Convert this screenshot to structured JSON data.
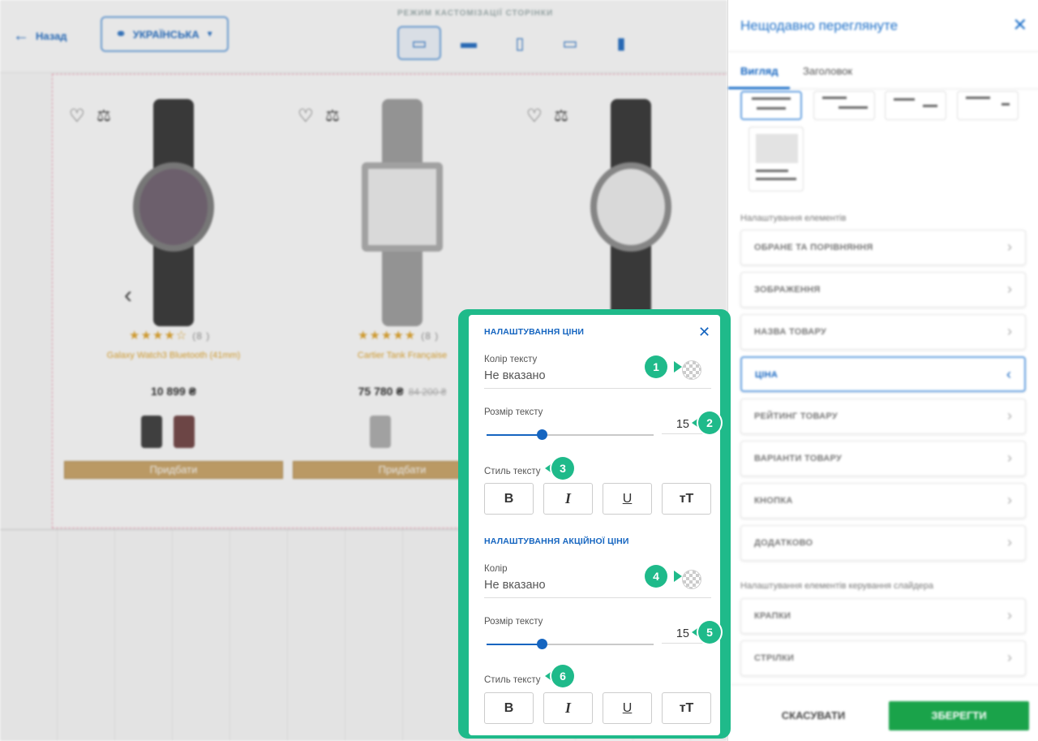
{
  "header": {
    "back_label": "Назад",
    "language_label": "УКРАЇНСЬКА",
    "mode_title": "РЕЖИМ КАСТОМІЗАЦІЇ СТОРІНКИ"
  },
  "products": [
    {
      "name": "Galaxy Watch3 Bluetooth (41mm)",
      "price": "10 899 ₴",
      "old_price": "",
      "rating_count": "(8 )",
      "buy_label": "Придбати"
    },
    {
      "name": "Cartier Tank Française",
      "price": "75 780 ₴",
      "old_price": "84 200 ₴",
      "rating_count": "(8 )",
      "buy_label": "Придбати"
    }
  ],
  "panel": {
    "title": "Нещодавно переглянуте",
    "tabs": [
      "Вигляд",
      "Заголовок"
    ],
    "elements_label": "Налаштування елементів",
    "items": [
      "ОБРАНЕ ТА ПОРІВНЯННЯ",
      "ЗОБРАЖЕННЯ",
      "НАЗВА ТОВАРУ",
      "ЦІНА",
      "РЕЙТИНГ ТОВАРУ",
      "ВАРІАНТИ ТОВАРУ",
      "КНОПКА",
      "ДОДАТКОВО"
    ],
    "slider_label": "Налаштування елементів керування слайдера",
    "slider_items": [
      "КРАПКИ",
      "СТРІЛКИ"
    ],
    "cancel_label": "СКАСУВАТИ",
    "save_label": "ЗБЕРЕГТИ"
  },
  "popup": {
    "price_section_title": "НАЛАШТУВАННЯ ЦІНИ",
    "text_color_label": "Колір тексту",
    "text_color_value": "Не вказано",
    "text_size_label": "Розмір тексту",
    "text_size_value": "15",
    "text_size_fraction": 0.33,
    "text_style_label": "Стиль тексту",
    "sale_section_title": "НАЛАШТУВАННЯ АКЦІЙНОЇ ЦІНИ",
    "sale_color_label": "Колір",
    "sale_color_value": "Не вказано",
    "sale_size_label": "Розмір тексту",
    "sale_size_value": "15",
    "sale_size_fraction": 0.33,
    "sale_style_label": "Стиль тексту",
    "style_buttons": [
      "B",
      "I",
      "U",
      "тT"
    ]
  },
  "markers": [
    "1",
    "2",
    "3",
    "4",
    "5",
    "6"
  ],
  "colors": {
    "accent": "#1565c0",
    "marker": "#1fba8a",
    "save": "#1aa34a"
  },
  "icons": [
    "back-arrow-icon",
    "globe-icon",
    "chevron-down-icon",
    "desktop-icon",
    "laptop-icon",
    "tablet-icon",
    "tablet-landscape-icon",
    "mobile-icon",
    "heart-icon",
    "compare-icon",
    "close-icon",
    "chevron-right-icon",
    "chevron-left-icon"
  ]
}
